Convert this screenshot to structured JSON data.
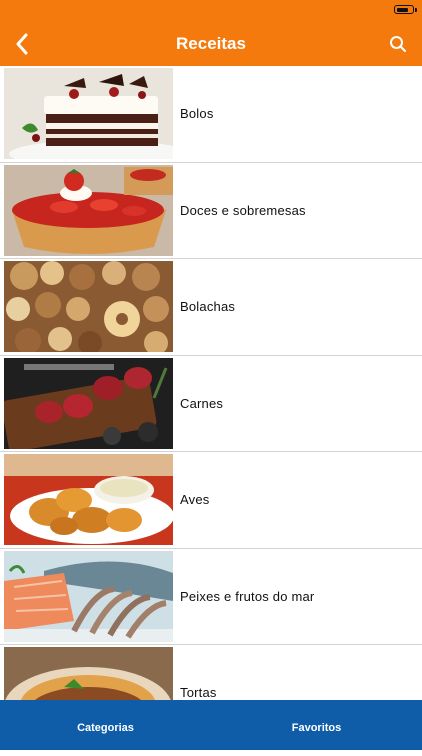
{
  "colors": {
    "accent": "#f57a0e",
    "tabbar": "#0f5da8",
    "separator": "#d3d3d3"
  },
  "statusbar": {
    "battery_icon": "battery-icon",
    "battery_level": 0.85
  },
  "navbar": {
    "title": "Receitas",
    "back_icon": "chevron-left-icon",
    "search_icon": "search-icon"
  },
  "categories": [
    {
      "label": "Bolos",
      "image": "cake-image"
    },
    {
      "label": "Doces e sobremesas",
      "image": "strawberry-tart-image"
    },
    {
      "label": "Bolachas",
      "image": "cookies-image"
    },
    {
      "label": "Carnes",
      "image": "steaks-image"
    },
    {
      "label": "Aves",
      "image": "fried-chicken-image"
    },
    {
      "label": "Peixes e frutos do mar",
      "image": "seafood-image"
    },
    {
      "label": "Tortas",
      "image": "pie-image"
    }
  ],
  "tabbar": {
    "left": "Categorias",
    "right": "Favoritos"
  }
}
